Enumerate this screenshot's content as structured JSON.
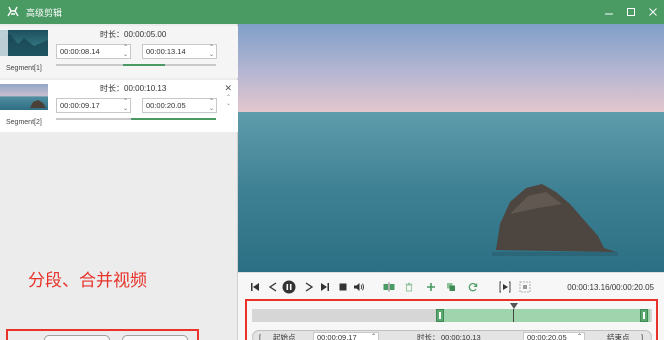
{
  "window": {
    "title": "高级剪辑",
    "brand_color": "#4a9a63",
    "controls": [
      "minimize-icon",
      "maximize-icon",
      "close-icon"
    ]
  },
  "segments": [
    {
      "label": "Segment[1]",
      "duration_label": "时长：",
      "duration": "00:00:05.00",
      "start": "00:00:08.14",
      "end": "00:00:13.14",
      "bar_fill": [
        0.42,
        0.68
      ]
    },
    {
      "label": "Segment[2]",
      "duration_label": "时长：",
      "duration": "00:00:10.13",
      "start": "00:00:09.17",
      "end": "00:00:20.05",
      "bar_fill": [
        0.47,
        1.0
      ]
    }
  ],
  "annotation": {
    "text": "分段、合并视频",
    "color": "#e8322a"
  },
  "player": {
    "time_readout": "00:00:13.16/00:00:20.05",
    "icons": [
      "prev-frame-icon",
      "rewind-icon",
      "pause-icon",
      "forward-icon",
      "next-frame-icon",
      "stop-icon",
      "volume-icon",
      "split-icon",
      "delete-icon",
      "add-icon",
      "copy-icon",
      "reset-icon",
      "mark-in-icon",
      "mark-out-icon"
    ]
  },
  "timeline": {
    "selection": [
      0.47,
      1.0
    ],
    "playhead": 0.66
  },
  "edit_row": {
    "start_label": "起始点",
    "start_value": "00:00:09.17",
    "duration_label": "时长：",
    "duration_value": "00:00:10.13",
    "end_value": "00:00:20.05",
    "end_label": "结束点"
  }
}
